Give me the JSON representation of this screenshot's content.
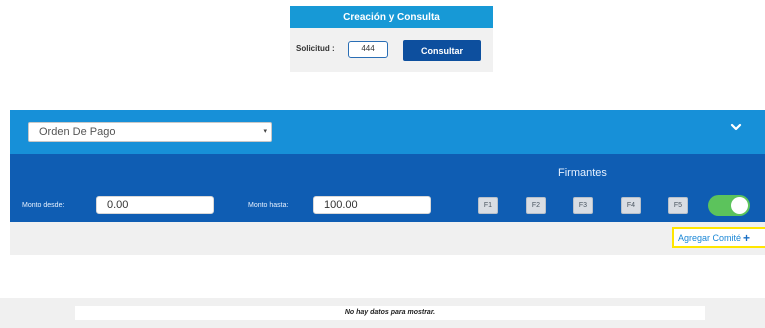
{
  "query": {
    "title": "Creación y Consulta",
    "label": "Solicitud :",
    "value": "444",
    "button_label": "Consultar"
  },
  "filter": {
    "type_select": "Orden De Pago",
    "signers_title": "Firmantes",
    "amount_from_label": "Monto desde:",
    "amount_from_value": "0.00",
    "amount_to_label": "Monto hasta:",
    "amount_to_value": "100.00",
    "signers": [
      "F1",
      "F2",
      "F3",
      "F4",
      "F5"
    ],
    "toggle_on": true,
    "add_committee_label": "Agregar Comité"
  },
  "table": {
    "empty_message": "No hay datos para mostrar."
  },
  "colors": {
    "header_blue": "#1790d8",
    "panel_blue": "#0f5db3",
    "button_blue": "#0d4f9e",
    "toggle_green": "#5cc35c",
    "highlight_yellow": "#ffe600"
  }
}
